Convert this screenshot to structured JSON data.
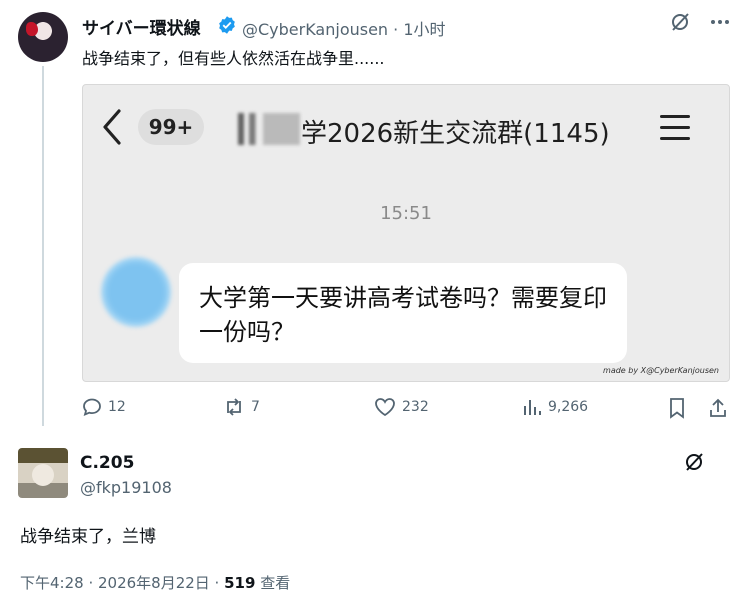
{
  "tweet": {
    "display_name": "サイバー環状線",
    "handle": "@CyberKanjousen",
    "time": "· 1小时",
    "text": "战争结束了，但有些人依然活在战争里......",
    "verified_color": "#1d9bf0"
  },
  "media": {
    "back_icon": "chevron-left-icon",
    "unread_badge": "99+",
    "group_title": "学2026新生交流群(1145)",
    "timestamp": "15:51",
    "message": "大学第一天要讲高考试卷吗？需要复印一份吗？",
    "signature": "made by X@CyberKanjousen"
  },
  "actions": {
    "replies": "12",
    "retweets": "7",
    "likes": "232",
    "views": "9,266"
  },
  "reply": {
    "display_name": "C.205",
    "handle": "@fkp19108",
    "text": "战争结束了，兰博",
    "meta_date": "下午4:28 · 2026年8月22日 · ",
    "meta_views": "519",
    "meta_views_label": " 查看"
  }
}
